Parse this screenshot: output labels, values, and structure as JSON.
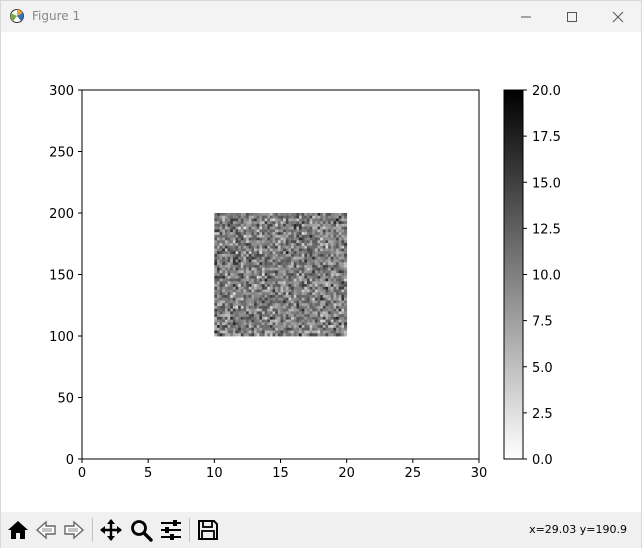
{
  "window": {
    "title": "Figure 1",
    "controls": [
      "minimize",
      "maximize",
      "close"
    ]
  },
  "chart_data": {
    "type": "heatmap",
    "colormap": "gray_r",
    "extent": {
      "x": [
        10,
        20
      ],
      "y": [
        100,
        200
      ]
    },
    "grid": {
      "cols": 50,
      "rows": 45
    },
    "value_range": [
      0,
      20
    ],
    "xlim": [
      0,
      30
    ],
    "ylim": [
      0,
      300
    ],
    "xticks": [
      "0",
      "5",
      "10",
      "15",
      "20",
      "25",
      "30"
    ],
    "yticks": [
      "0",
      "50",
      "100",
      "150",
      "200",
      "250",
      "300"
    ],
    "colorbar": {
      "range": [
        0,
        20
      ],
      "ticks": [
        "0.0",
        "2.5",
        "5.0",
        "7.5",
        "10.0",
        "12.5",
        "15.0",
        "17.5",
        "20.0"
      ]
    },
    "title": "",
    "xlabel": "",
    "ylabel": ""
  },
  "toolbar": {
    "tools": [
      {
        "name": "home-icon"
      },
      {
        "name": "back-icon"
      },
      {
        "name": "forward-icon"
      },
      {
        "name": "pan-icon"
      },
      {
        "name": "zoom-icon"
      },
      {
        "name": "configure-subplots-icon"
      },
      {
        "name": "save-icon"
      }
    ],
    "coords": "x=29.03 y=190.9"
  }
}
